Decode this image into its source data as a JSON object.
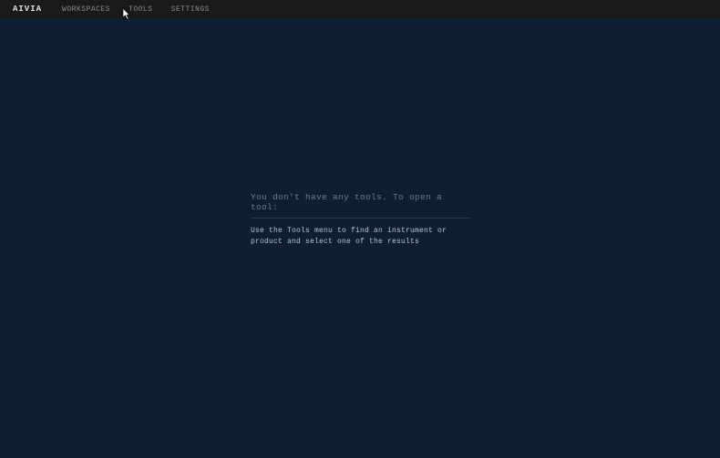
{
  "header": {
    "brand": "AIVIA",
    "nav": [
      {
        "label": "WORKSPACES"
      },
      {
        "label": "TOOLS"
      },
      {
        "label": "SETTINGS"
      }
    ]
  },
  "empty_state": {
    "heading": "You don't have any tools. To open a tool:",
    "body": "Use the Tools menu to find an instrument or product and select one of the results"
  }
}
